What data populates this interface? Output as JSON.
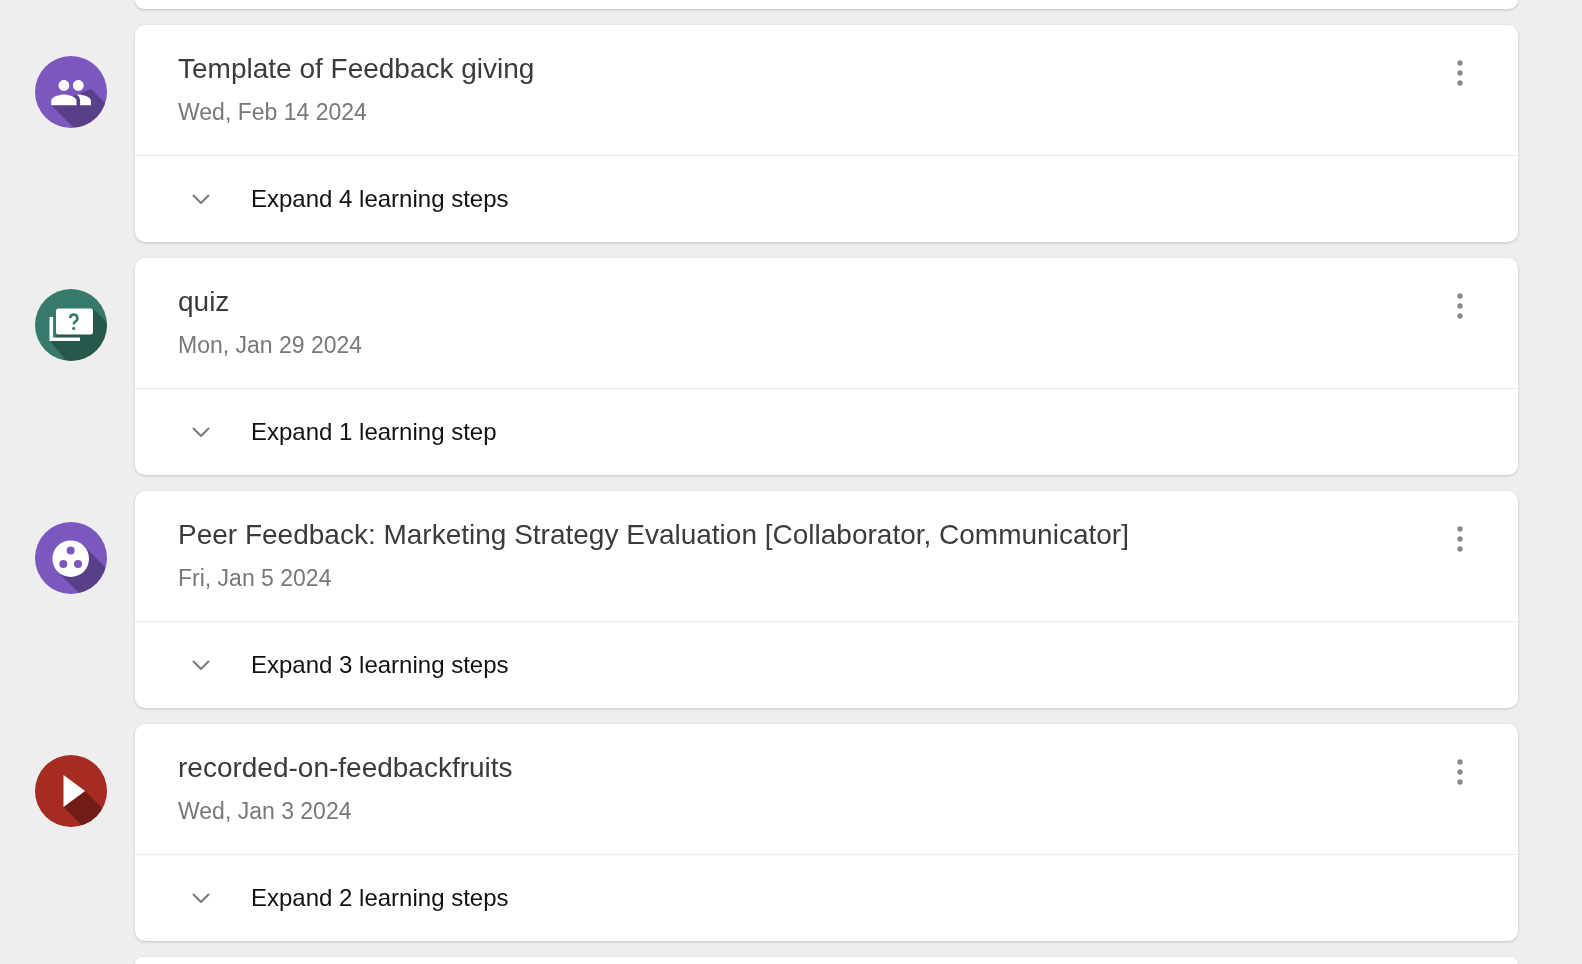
{
  "activities": [
    {
      "kind": "discussion",
      "color": "#7b58bd",
      "title": "Template of Feedback giving",
      "date": "Wed, Feb 14 2024",
      "expand_label": "Expand 4 learning steps",
      "expanded": false
    },
    {
      "kind": "quiz",
      "color": "#37796b",
      "title": "quiz",
      "date": "Mon, Jan 29 2024",
      "expand_label": "Expand 1 learning step",
      "expanded": false
    },
    {
      "kind": "peer-review",
      "color": "#7b58bd",
      "title": "Peer Feedback: Marketing Strategy Evaluation [Collaborator, Communicator]",
      "date": "Fri, Jan 5 2024",
      "expand_label": "Expand 3 learning steps",
      "expanded": false
    },
    {
      "kind": "video",
      "color": "#a52b23",
      "title": "recorded-on-feedbackfruits",
      "date": "Wed, Jan 3 2024",
      "expand_label": "Expand 2 learning steps",
      "expanded": false
    }
  ]
}
